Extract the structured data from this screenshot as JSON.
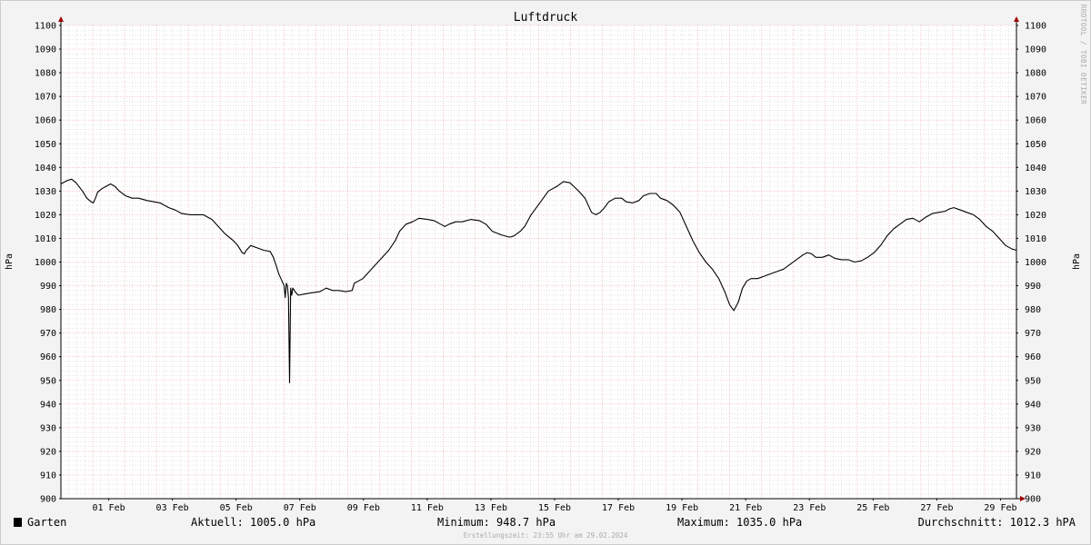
{
  "chart_data": {
    "type": "line",
    "title": "Luftdruck",
    "ylabel": "hPa",
    "ylabel_right": "hPa",
    "ylim": [
      900,
      1100
    ],
    "yticks": [
      900,
      910,
      920,
      930,
      940,
      950,
      960,
      970,
      980,
      990,
      1000,
      1010,
      1020,
      1030,
      1040,
      1050,
      1060,
      1070,
      1080,
      1090,
      1100
    ],
    "xlim_days": [
      0,
      30
    ],
    "xticks": [
      {
        "day": 1.5,
        "label": "01 Feb"
      },
      {
        "day": 3.5,
        "label": "03 Feb"
      },
      {
        "day": 5.5,
        "label": "05 Feb"
      },
      {
        "day": 7.5,
        "label": "07 Feb"
      },
      {
        "day": 9.5,
        "label": "09 Feb"
      },
      {
        "day": 11.5,
        "label": "11 Feb"
      },
      {
        "day": 13.5,
        "label": "13 Feb"
      },
      {
        "day": 15.5,
        "label": "15 Feb"
      },
      {
        "day": 17.5,
        "label": "17 Feb"
      },
      {
        "day": 19.5,
        "label": "19 Feb"
      },
      {
        "day": 21.5,
        "label": "21 Feb"
      },
      {
        "day": 23.5,
        "label": "23 Feb"
      },
      {
        "day": 25.5,
        "label": "25 Feb"
      },
      {
        "day": 27.5,
        "label": "27 Feb"
      },
      {
        "day": 29.5,
        "label": "29 Feb"
      }
    ],
    "grid": true,
    "series": [
      {
        "name": "Garten",
        "color": "#000000",
        "points": [
          [
            0.0,
            1033
          ],
          [
            0.3,
            1034.5
          ],
          [
            0.5,
            1035
          ],
          [
            0.7,
            1033.5
          ],
          [
            1.0,
            1030
          ],
          [
            1.2,
            1027
          ],
          [
            1.4,
            1025.5
          ],
          [
            1.5,
            1025
          ],
          [
            1.6,
            1027
          ],
          [
            1.7,
            1029.5
          ],
          [
            1.9,
            1031
          ],
          [
            2.1,
            1032
          ],
          [
            2.3,
            1033
          ],
          [
            2.5,
            1032
          ],
          [
            2.7,
            1030
          ],
          [
            3.0,
            1028
          ],
          [
            3.3,
            1027
          ],
          [
            3.6,
            1027
          ],
          [
            4.0,
            1026
          ],
          [
            4.3,
            1025.5
          ],
          [
            4.6,
            1025
          ],
          [
            5.0,
            1023
          ],
          [
            5.3,
            1022
          ],
          [
            5.6,
            1020.5
          ],
          [
            6.0,
            1020
          ],
          [
            6.3,
            1020
          ],
          [
            6.6,
            1020
          ],
          [
            6.8,
            1019
          ],
          [
            7.0,
            1018
          ],
          [
            7.3,
            1015
          ],
          [
            7.6,
            1012
          ],
          [
            8.0,
            1009
          ],
          [
            8.2,
            1007
          ],
          [
            8.4,
            1004
          ],
          [
            8.5,
            1003.5
          ],
          [
            8.6,
            1005
          ],
          [
            8.8,
            1007
          ],
          [
            9.1,
            1006
          ],
          [
            9.4,
            1005
          ],
          [
            9.7,
            1004.5
          ],
          [
            9.85,
            1002
          ],
          [
            10.0,
            998
          ],
          [
            10.1,
            995
          ],
          [
            10.2,
            993
          ],
          [
            10.35,
            990
          ],
          [
            10.4,
            985
          ],
          [
            10.45,
            991
          ],
          [
            10.5,
            990
          ],
          [
            10.55,
            985
          ],
          [
            10.6,
            949
          ],
          [
            10.65,
            989
          ],
          [
            10.7,
            986
          ],
          [
            10.75,
            989
          ],
          [
            10.9,
            987
          ],
          [
            11.0,
            986
          ],
          [
            11.3,
            986.5
          ],
          [
            11.6,
            987
          ],
          [
            12.0,
            987.5
          ],
          [
            12.3,
            989
          ],
          [
            12.6,
            988
          ],
          [
            12.9,
            988
          ],
          [
            13.2,
            987.5
          ],
          [
            13.5,
            988
          ],
          [
            13.6,
            991
          ],
          [
            13.8,
            992
          ],
          [
            14.0,
            993
          ],
          [
            14.4,
            997
          ],
          [
            14.8,
            1001
          ],
          [
            15.2,
            1005
          ],
          [
            15.5,
            1009
          ],
          [
            15.7,
            1013
          ],
          [
            16.0,
            1016
          ],
          [
            16.3,
            1017
          ],
          [
            16.6,
            1018.5
          ],
          [
            17.0,
            1018
          ],
          [
            17.3,
            1017.5
          ],
          [
            17.6,
            1016
          ],
          [
            17.8,
            1015
          ],
          [
            18.0,
            1016
          ],
          [
            18.3,
            1017
          ],
          [
            18.6,
            1017
          ],
          [
            19.0,
            1018
          ],
          [
            19.4,
            1017.5
          ],
          [
            19.7,
            1016
          ],
          [
            20.0,
            1013
          ],
          [
            20.4,
            1011.5
          ],
          [
            20.8,
            1010.5
          ],
          [
            21.0,
            1011
          ],
          [
            21.3,
            1013
          ],
          [
            21.5,
            1015
          ],
          [
            21.8,
            1020
          ],
          [
            22.2,
            1025
          ],
          [
            22.6,
            1030
          ],
          [
            23.0,
            1032
          ],
          [
            23.3,
            1034
          ],
          [
            23.6,
            1033.5
          ],
          [
            24.0,
            1030
          ],
          [
            24.3,
            1027
          ],
          [
            24.6,
            1021
          ],
          [
            24.8,
            1020
          ],
          [
            25.0,
            1021
          ],
          [
            25.2,
            1023
          ],
          [
            25.4,
            1025.5
          ],
          [
            25.7,
            1027
          ],
          [
            26.0,
            1027
          ],
          [
            26.2,
            1025.5
          ],
          [
            26.5,
            1025
          ],
          [
            26.8,
            1026
          ],
          [
            27.0,
            1028
          ],
          [
            27.3,
            1029
          ],
          [
            27.6,
            1029
          ],
          [
            27.8,
            1027
          ],
          [
            28.1,
            1026
          ],
          [
            28.4,
            1024
          ],
          [
            28.7,
            1021
          ],
          [
            29.0,
            1015
          ],
          [
            29.3,
            1009
          ],
          [
            29.6,
            1004
          ],
          [
            29.9,
            1000
          ],
          [
            30.2,
            997
          ],
          [
            30.5,
            993
          ],
          [
            30.8,
            987
          ],
          [
            31.0,
            982
          ],
          [
            31.2,
            979.5
          ],
          [
            31.4,
            983
          ],
          [
            31.6,
            989
          ],
          [
            31.8,
            992
          ],
          [
            32.0,
            993
          ],
          [
            32.3,
            993
          ],
          [
            32.6,
            994
          ],
          [
            32.9,
            995
          ],
          [
            33.2,
            996
          ],
          [
            33.5,
            997
          ],
          [
            33.8,
            999
          ],
          [
            34.1,
            1001
          ],
          [
            34.4,
            1003
          ],
          [
            34.6,
            1004
          ],
          [
            34.8,
            1003.5
          ],
          [
            35.0,
            1002
          ],
          [
            35.3,
            1002
          ],
          [
            35.6,
            1003
          ],
          [
            35.9,
            1001.5
          ],
          [
            36.2,
            1001
          ],
          [
            36.5,
            1001
          ],
          [
            36.8,
            1000
          ],
          [
            37.1,
            1000.5
          ],
          [
            37.4,
            1002
          ],
          [
            37.7,
            1004
          ],
          [
            38.0,
            1007
          ],
          [
            38.3,
            1011
          ],
          [
            38.6,
            1014
          ],
          [
            38.9,
            1016
          ],
          [
            39.2,
            1018
          ],
          [
            39.5,
            1018.5
          ],
          [
            39.8,
            1017
          ],
          [
            40.1,
            1019
          ],
          [
            40.4,
            1020.5
          ],
          [
            40.7,
            1021
          ],
          [
            41.0,
            1021.5
          ],
          [
            41.2,
            1022.5
          ],
          [
            41.4,
            1023
          ],
          [
            41.7,
            1022
          ],
          [
            42.0,
            1021
          ],
          [
            42.3,
            1020
          ],
          [
            42.6,
            1018
          ],
          [
            42.9,
            1015
          ],
          [
            43.2,
            1013
          ],
          [
            43.5,
            1010
          ],
          [
            43.8,
            1007
          ],
          [
            44.1,
            1005.5
          ],
          [
            44.3,
            1005
          ]
        ]
      }
    ]
  },
  "watermark": "RRDTOOL / TOBI OETIKER",
  "legend": {
    "series_name": "Garten",
    "aktuell": "Aktuell: 1005.0 hPa",
    "minimum": "Minimum: 948.7 hPa",
    "maximum": "Maximum: 1035.0 hPa",
    "durchschnitt": "Durchschnitt: 1012.3 hPA"
  },
  "footer": "Erstellungszeit: 23:55 Uhr am 29.02.2024",
  "colors": {
    "background": "#f3f3f3",
    "plot_background": "#ffffff",
    "major_grid": "#e8a0a0",
    "minor_grid": "#c8c8c8",
    "axis": "#000000",
    "arrow": "#a00000"
  }
}
